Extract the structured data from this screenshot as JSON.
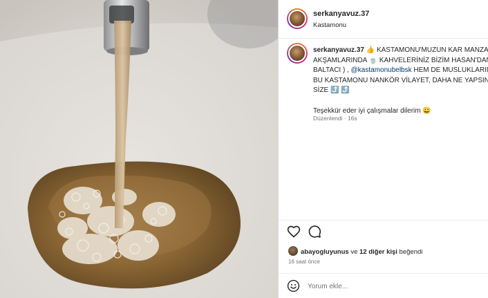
{
  "post": {
    "username": "serkanyavuz.37",
    "location": "Kastamonu",
    "caption": {
      "username": "serkanyavuz.37",
      "line1_text": " 👍 KASTAMONU'MUZUN KAR MANZAR",
      "line2": "AKŞAMLARINDA 🍵 KAHVELERİNİZ BİZİM HASAN'DAN",
      "line3_pre": "BALTACI ) , ",
      "mention": "@kastamonubelbsk",
      "line3_post": " HEM DE MUSLUKLARIM",
      "line4": "BU KASTAMONU NANKÖR VİLAYET, DAHA NE YAPSIN E",
      "line5": "SİZE",
      "line5_emoji": "⤴️ ⤴️",
      "thanks": "Teşekkür eder iyi çalışmalar dilerim",
      "thanks_emoji": "😀"
    },
    "edited": "Düzenlendi · 16s",
    "likes": {
      "first_user": "abayogluyunus",
      "connector": " ve ",
      "others": "12 diğer kişi",
      "suffix": " beğendi"
    },
    "time_ago": "16 saat önce",
    "comment_placeholder": "Yorum ekle..."
  },
  "icons": {
    "like": "heart-icon",
    "comment": "comment-bubble-icon",
    "emoji": "emoji-smile-icon"
  },
  "colors": {
    "mention": "#00376b",
    "secondary_text": "#737373",
    "story_ring": "#dd2a7b"
  }
}
